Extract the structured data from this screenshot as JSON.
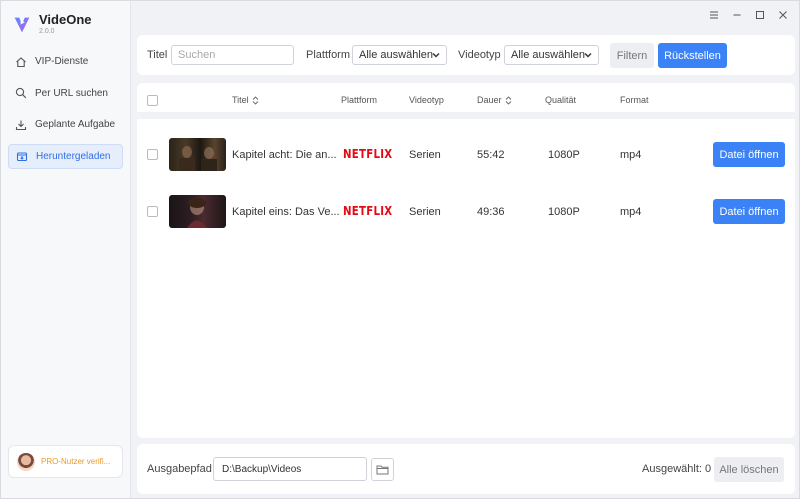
{
  "app": {
    "name": "VideOne",
    "version": "2.0.0"
  },
  "sidebar": {
    "items": [
      {
        "label": "VIP-Dienste",
        "icon": "home-icon"
      },
      {
        "label": "Per URL suchen",
        "icon": "search-icon"
      },
      {
        "label": "Geplante Aufgabe",
        "icon": "download-icon"
      },
      {
        "label": "Heruntergeladen",
        "icon": "downloaded-box-icon",
        "active": true
      }
    ],
    "pro_label": "PRO-Nutzer verifi..."
  },
  "window_controls": [
    "menu-icon",
    "minimize-icon",
    "maximize-icon",
    "close-icon"
  ],
  "filter": {
    "title_label": "Titel",
    "search_placeholder": "Suchen",
    "platform_label": "Plattform",
    "platform_value": "Alle auswählen",
    "type_label": "Videotyp",
    "type_value": "Alle auswählen",
    "filter_button": "Filtern",
    "reset_button": "Rückstellen"
  },
  "table": {
    "headers": {
      "title": "Titel",
      "platform": "Plattform",
      "type": "Videotyp",
      "duration": "Dauer",
      "quality": "Qualität",
      "format": "Format"
    },
    "rows": [
      {
        "title": "Kapitel acht: Die an...",
        "platform": "NETFLIX",
        "type": "Serien",
        "duration": "55:42",
        "quality": "1080P",
        "format": "mp4",
        "action": "Datei öffnen"
      },
      {
        "title": "Kapitel eins: Das Ve...",
        "platform": "NETFLIX",
        "type": "Serien",
        "duration": "49:36",
        "quality": "1080P",
        "format": "mp4",
        "action": "Datei öffnen"
      }
    ]
  },
  "footer": {
    "path_label": "Ausgabepfad",
    "path_value": "D:\\Backup\\Videos",
    "selected_label": "Ausgewählt: 0",
    "delete_all_button": "Alle löschen"
  },
  "colors": {
    "accent": "#3b82f6",
    "netflix": "#e50914",
    "pro": "#e89a2c"
  }
}
